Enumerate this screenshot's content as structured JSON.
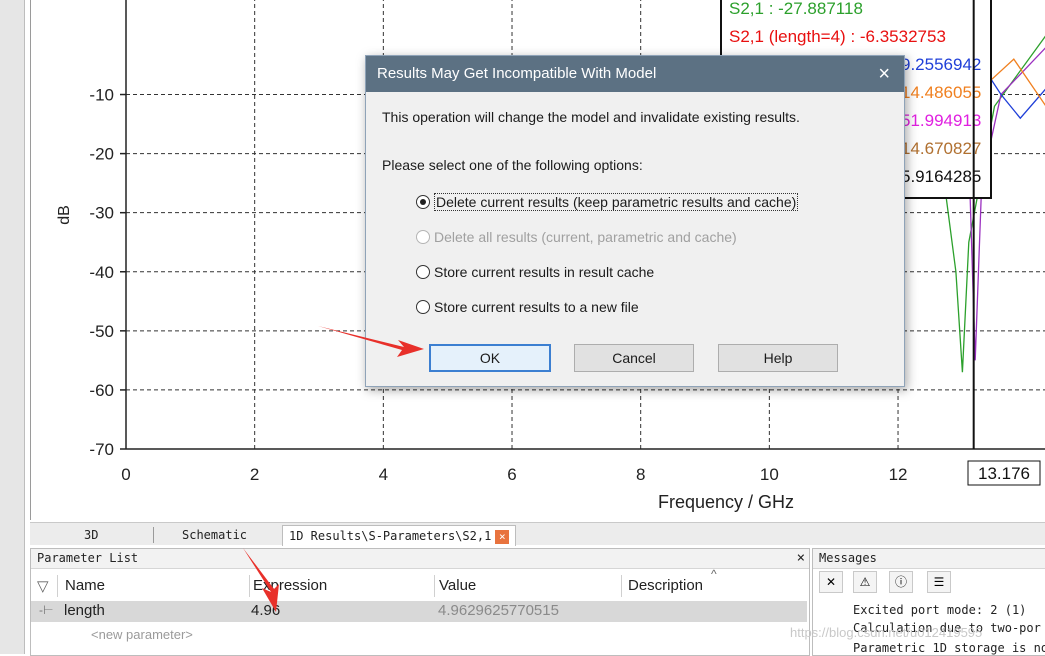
{
  "chart_data": {
    "type": "line",
    "xlabel": "Frequency / GHz",
    "ylabel": "dB",
    "xlim": [
      0,
      14.3
    ],
    "ylim": [
      -70,
      6
    ],
    "x_ticks": [
      "0",
      "2",
      "4",
      "6",
      "8",
      "10",
      "12"
    ],
    "y_ticks": [
      "-10",
      "-20",
      "-30",
      "-40",
      "-50",
      "-60",
      "-70"
    ],
    "marker_x": 13.176,
    "marker_label": "13.176",
    "grid": true,
    "legend_entries": [
      {
        "text": "S2,1 : -27.887118",
        "color": "#2ca02c"
      },
      {
        "text": "S2,1 (length=4) : -6.3532753",
        "color": "#e81010"
      },
      {
        "text": "9.2556942",
        "color": "#1f3fd8"
      },
      {
        "text": "14.486055",
        "color": "#f08020"
      },
      {
        "text": "51.994913",
        "color": "#e020e0"
      },
      {
        "text": "14.670827",
        "color": "#b07030"
      },
      {
        "text": "5.9164285",
        "color": "#111111"
      }
    ],
    "series": [
      {
        "color": "#2ca02c",
        "points": [
          [
            12.0,
            6
          ],
          [
            12.6,
            -15
          ],
          [
            12.9,
            -40
          ],
          [
            13.0,
            -57
          ],
          [
            13.1,
            -35
          ],
          [
            13.5,
            -12
          ],
          [
            14.3,
            0
          ]
        ]
      },
      {
        "color": "#9b30c0",
        "points": [
          [
            13.0,
            0
          ],
          [
            13.1,
            -20
          ],
          [
            13.2,
            -55
          ],
          [
            13.3,
            -25
          ],
          [
            13.6,
            -10
          ],
          [
            14.3,
            -2
          ]
        ]
      },
      {
        "color": "#1f3fd8",
        "points": [
          [
            13.3,
            -5
          ],
          [
            13.6,
            -10
          ],
          [
            13.9,
            -14
          ],
          [
            14.3,
            -9
          ]
        ]
      },
      {
        "color": "#f08020",
        "points": [
          [
            13.4,
            -8
          ],
          [
            13.8,
            -4
          ],
          [
            14.3,
            -12
          ]
        ]
      },
      {
        "color": "#b07030",
        "points": [
          [
            11.6,
            -38
          ],
          [
            11.65,
            -42
          ],
          [
            11.7,
            -38
          ],
          [
            11.8,
            -33
          ]
        ]
      }
    ]
  },
  "tabs": {
    "tab_3d": "3D",
    "tab_schematic": "Schematic",
    "tab_results": "1D Results\\S-Parameters\\S2,1",
    "close_glyph": "×"
  },
  "parameter_list": {
    "title": "Parameter List",
    "close_glyph": "×",
    "filter_glyph": "▽",
    "columns": [
      "Name",
      "Expression",
      "Value",
      "Description"
    ],
    "sort_glyph": "^",
    "rows": [
      {
        "icon": "-⊢",
        "name": "length",
        "expression": "4.96",
        "value": "4.9629625770515"
      }
    ],
    "new_param": "<new parameter>"
  },
  "messages": {
    "title": "Messages",
    "lines": [
      "Excited port mode: 2 (1)",
      "Calculation due to two-por",
      "Parametric 1D storage is no"
    ],
    "watermark": "https://blog.csdn.net/u012419595"
  },
  "dialog": {
    "title": "Results May Get Incompatible With Model",
    "close_glyph": "×",
    "message": "This operation will change the model and invalidate existing results.",
    "prompt": "Please select one of the following options:",
    "options": [
      {
        "label": "Delete current results (keep parametric results and cache)",
        "selected": true,
        "disabled": false
      },
      {
        "label": "Delete all results (current, parametric and cache)",
        "selected": false,
        "disabled": true
      },
      {
        "label": "Store current results in result cache",
        "selected": false,
        "disabled": false
      },
      {
        "label": "Store current results to a new file",
        "selected": false,
        "disabled": false
      }
    ],
    "ok": "OK",
    "cancel": "Cancel",
    "help": "Help"
  },
  "annotation_color": "#e8302a"
}
